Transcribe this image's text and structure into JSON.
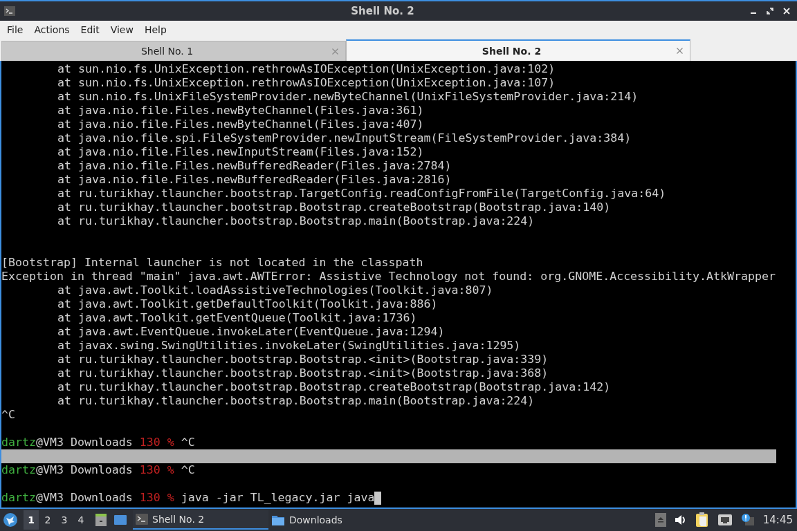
{
  "window": {
    "title": "Shell No. 2"
  },
  "menu": [
    "File",
    "Actions",
    "Edit",
    "View",
    "Help"
  ],
  "tabs": [
    {
      "label": "Shell No. 1",
      "selected": false
    },
    {
      "label": "Shell No. 2",
      "selected": true
    }
  ],
  "terminal": {
    "lines": [
      {
        "kind": "trace",
        "text": "at sun.nio.fs.UnixException.rethrowAsIOException(UnixException.java:102)"
      },
      {
        "kind": "trace",
        "text": "at sun.nio.fs.UnixException.rethrowAsIOException(UnixException.java:107)"
      },
      {
        "kind": "trace",
        "text": "at sun.nio.fs.UnixFileSystemProvider.newByteChannel(UnixFileSystemProvider.java:214)"
      },
      {
        "kind": "trace",
        "text": "at java.nio.file.Files.newByteChannel(Files.java:361)"
      },
      {
        "kind": "trace",
        "text": "at java.nio.file.Files.newByteChannel(Files.java:407)"
      },
      {
        "kind": "trace",
        "text": "at java.nio.file.spi.FileSystemProvider.newInputStream(FileSystemProvider.java:384)"
      },
      {
        "kind": "trace",
        "text": "at java.nio.file.Files.newInputStream(Files.java:152)"
      },
      {
        "kind": "trace",
        "text": "at java.nio.file.Files.newBufferedReader(Files.java:2784)"
      },
      {
        "kind": "trace",
        "text": "at java.nio.file.Files.newBufferedReader(Files.java:2816)"
      },
      {
        "kind": "trace",
        "text": "at ru.turikhay.tlauncher.bootstrap.TargetConfig.readConfigFromFile(TargetConfig.java:64)"
      },
      {
        "kind": "trace",
        "text": "at ru.turikhay.tlauncher.bootstrap.Bootstrap.createBootstrap(Bootstrap.java:140)"
      },
      {
        "kind": "trace",
        "text": "at ru.turikhay.tlauncher.bootstrap.Bootstrap.main(Bootstrap.java:224)"
      },
      {
        "kind": "blank"
      },
      {
        "kind": "blank"
      },
      {
        "kind": "text",
        "text": "[Bootstrap] Internal launcher is not located in the classpath"
      },
      {
        "kind": "text",
        "text": "Exception in thread \"main\" java.awt.AWTError: Assistive Technology not found: org.GNOME.Accessibility.AtkWrapper"
      },
      {
        "kind": "trace",
        "text": "at java.awt.Toolkit.loadAssistiveTechnologies(Toolkit.java:807)"
      },
      {
        "kind": "trace",
        "text": "at java.awt.Toolkit.getDefaultToolkit(Toolkit.java:886)"
      },
      {
        "kind": "trace",
        "text": "at java.awt.Toolkit.getEventQueue(Toolkit.java:1736)"
      },
      {
        "kind": "trace",
        "text": "at java.awt.EventQueue.invokeLater(EventQueue.java:1294)"
      },
      {
        "kind": "trace",
        "text": "at javax.swing.SwingUtilities.invokeLater(SwingUtilities.java:1295)"
      },
      {
        "kind": "trace",
        "text": "at ru.turikhay.tlauncher.bootstrap.Bootstrap.<init>(Bootstrap.java:339)"
      },
      {
        "kind": "trace",
        "text": "at ru.turikhay.tlauncher.bootstrap.Bootstrap.<init>(Bootstrap.java:368)"
      },
      {
        "kind": "trace",
        "text": "at ru.turikhay.tlauncher.bootstrap.Bootstrap.createBootstrap(Bootstrap.java:142)"
      },
      {
        "kind": "trace",
        "text": "at ru.turikhay.tlauncher.bootstrap.Bootstrap.main(Bootstrap.java:224)"
      },
      {
        "kind": "text",
        "text": "^C"
      },
      {
        "kind": "blank"
      },
      {
        "kind": "prompt",
        "user": "dartz",
        "host": "@VM3 Downloads",
        "status": "130 %",
        "command": "^C",
        "cursor": false
      },
      {
        "kind": "selection"
      },
      {
        "kind": "prompt",
        "user": "dartz",
        "host": "@VM3 Downloads",
        "status": "130 %",
        "command": "^C",
        "cursor": false
      },
      {
        "kind": "blank"
      },
      {
        "kind": "prompt",
        "user": "dartz",
        "host": "@VM3 Downloads",
        "status": "130 %",
        "command": "java -jar TL_legacy.jar java",
        "cursor": true
      }
    ]
  },
  "taskbar": {
    "desktops": [
      {
        "label": "1",
        "selected": true
      },
      {
        "label": "2",
        "selected": false
      },
      {
        "label": "3",
        "selected": false
      },
      {
        "label": "4",
        "selected": false
      }
    ],
    "tasks": [
      {
        "kind": "terminal",
        "label": "Shell No. 2",
        "selected": true
      },
      {
        "kind": "folder",
        "label": "Downloads",
        "selected": false
      }
    ],
    "clock": "14:45"
  }
}
